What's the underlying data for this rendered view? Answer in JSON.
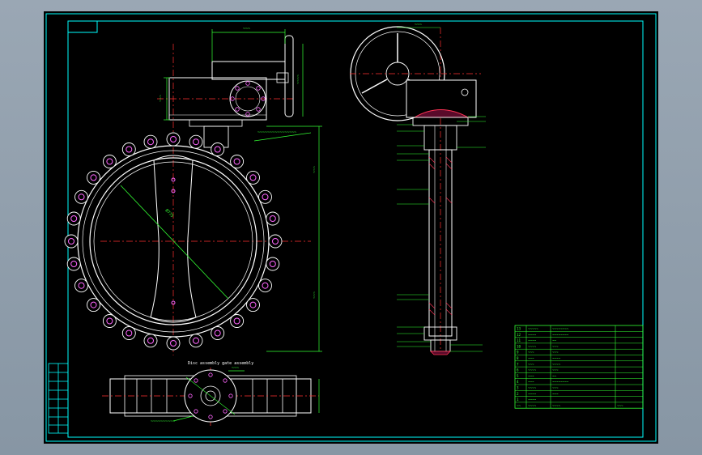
{
  "colors": {
    "background": "#000000",
    "border": "#00ffff",
    "outline": "#ffffff",
    "centerline": "#ff3030",
    "dimension": "#33ff33",
    "bolt": "#ff66ff",
    "hatch": "#ff3355"
  },
  "labels": {
    "dim_top_front": "~~~",
    "dim_top_side": "~~~",
    "bolt_note": "~~~~~~~~~~~~~~~~",
    "disc_assembly": "Disc assembly gate assembly",
    "bottom_note": "~~~~~~~~~~",
    "bottom_tag": "~~~"
  },
  "title_block": {
    "rows": [
      [
        "13",
        "~~~~~",
        "~~~~~~~~",
        ""
      ],
      [
        "12",
        "~~~~",
        "~~~~~~~~",
        ""
      ],
      [
        "11",
        "~~~~",
        "~~",
        ""
      ],
      [
        "10",
        "~~~~",
        "~~~",
        ""
      ],
      [
        "9",
        "~~~",
        "~~~",
        ""
      ],
      [
        "8",
        "~~~",
        "~~~~",
        ""
      ],
      [
        "7",
        "~~~",
        "~~~~",
        ""
      ],
      [
        "6",
        "~~~~",
        "~~~",
        ""
      ],
      [
        "5",
        "~~~",
        "~~",
        ""
      ],
      [
        "4",
        "~~~",
        "~~~~~~~~",
        ""
      ],
      [
        "3",
        "~~~~",
        "~~~",
        ""
      ],
      [
        "2",
        "~~~~",
        "~~~",
        ""
      ],
      [
        "1",
        "~~~~",
        "",
        ""
      ],
      [
        "~~",
        "~~~~",
        "~~~~",
        "~~~"
      ]
    ]
  }
}
